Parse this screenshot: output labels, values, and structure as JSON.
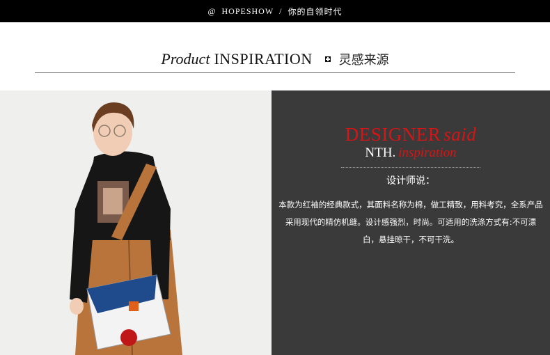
{
  "topbar": {
    "at": "@",
    "brand": "HOPESHOW",
    "sep": "/",
    "slogan": "你的自领时代"
  },
  "section": {
    "title_italic": "Product",
    "title_caps": "INSPIRATION",
    "title_cn": "灵感来源"
  },
  "panel": {
    "designer": "DESIGNER",
    "said": "said",
    "nth": "NTH.",
    "inspiration": "inspiration",
    "said_cn": "设计师说：",
    "desc_lines": [
      "本款为红袖的经典款式，其面料名称为棉，做工精致，用料考究，全系产品",
      "采用现代的精仿机缝。设计感强烈，时尚。可适用的洗涤方式有:不可漂",
      "白，悬挂晾干，不可干洗。"
    ]
  },
  "colors": {
    "accent": "#d81414",
    "panel_bg": "#3a3a3a",
    "topbar_bg": "#000000"
  },
  "image": {
    "alt_icon": "model-photo"
  }
}
